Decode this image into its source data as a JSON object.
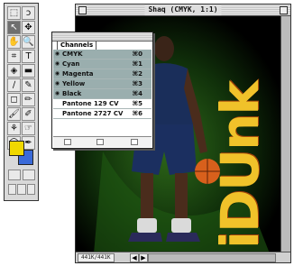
{
  "toolbox": {
    "tools": [
      {
        "glyph": "⬚",
        "name": "marquee-tool-icon",
        "selected": false
      },
      {
        "glyph": "ↄ",
        "name": "lasso-tool-icon",
        "selected": false
      },
      {
        "glyph": "↖",
        "name": "move-tool-icon",
        "selected": true
      },
      {
        "glyph": "✥",
        "name": "crop-tool-icon",
        "selected": false
      },
      {
        "glyph": "✋",
        "name": "hand-tool-icon",
        "selected": false
      },
      {
        "glyph": "🔍",
        "name": "zoom-tool-icon",
        "selected": false
      },
      {
        "glyph": "⌗",
        "name": "crop-frame-tool-icon",
        "selected": false
      },
      {
        "glyph": "T",
        "name": "type-tool-icon",
        "selected": false
      },
      {
        "glyph": "◈",
        "name": "paint-bucket-tool-icon",
        "selected": false
      },
      {
        "glyph": "▬",
        "name": "gradient-tool-icon",
        "selected": false
      },
      {
        "glyph": "∕",
        "name": "line-tool-icon",
        "selected": false
      },
      {
        "glyph": "✎",
        "name": "eyedropper-tool-icon",
        "selected": false
      },
      {
        "glyph": "◻",
        "name": "eraser-tool-icon",
        "selected": false
      },
      {
        "glyph": "✏",
        "name": "pencil-tool-icon",
        "selected": false
      },
      {
        "glyph": "🖌",
        "name": "airbrush-tool-icon",
        "selected": false
      },
      {
        "glyph": "✐",
        "name": "paintbrush-tool-icon",
        "selected": false
      },
      {
        "glyph": "⚘",
        "name": "rubber-stamp-tool-icon",
        "selected": false
      },
      {
        "glyph": "☞",
        "name": "smudge-tool-icon",
        "selected": false
      },
      {
        "glyph": "◯",
        "name": "dodge-tool-icon",
        "selected": false
      },
      {
        "glyph": "✒",
        "name": "pen-tool-icon",
        "selected": false
      }
    ]
  },
  "document": {
    "title": "Shaq (CMYK, 1:1)",
    "size_readout": "441K/441K",
    "image_text": "iDUnk"
  },
  "channels_palette": {
    "tab_label": "Channels",
    "rows": [
      {
        "name": "CMYK",
        "shortcut": "⌘0",
        "active": true
      },
      {
        "name": "Cyan",
        "shortcut": "⌘1",
        "active": true
      },
      {
        "name": "Magenta",
        "shortcut": "⌘2",
        "active": true
      },
      {
        "name": "Yellow",
        "shortcut": "⌘3",
        "active": true
      },
      {
        "name": "Black",
        "shortcut": "⌘4",
        "active": true
      },
      {
        "name": "Pantone 129 CV",
        "shortcut": "⌘5",
        "active": false
      },
      {
        "name": "Pantone 2727 CV",
        "shortcut": "⌘6",
        "active": false
      }
    ]
  },
  "colors": {
    "foreground": "#f0d800",
    "background": "#3a6ad8",
    "channel_highlight": "#9aaeae"
  }
}
